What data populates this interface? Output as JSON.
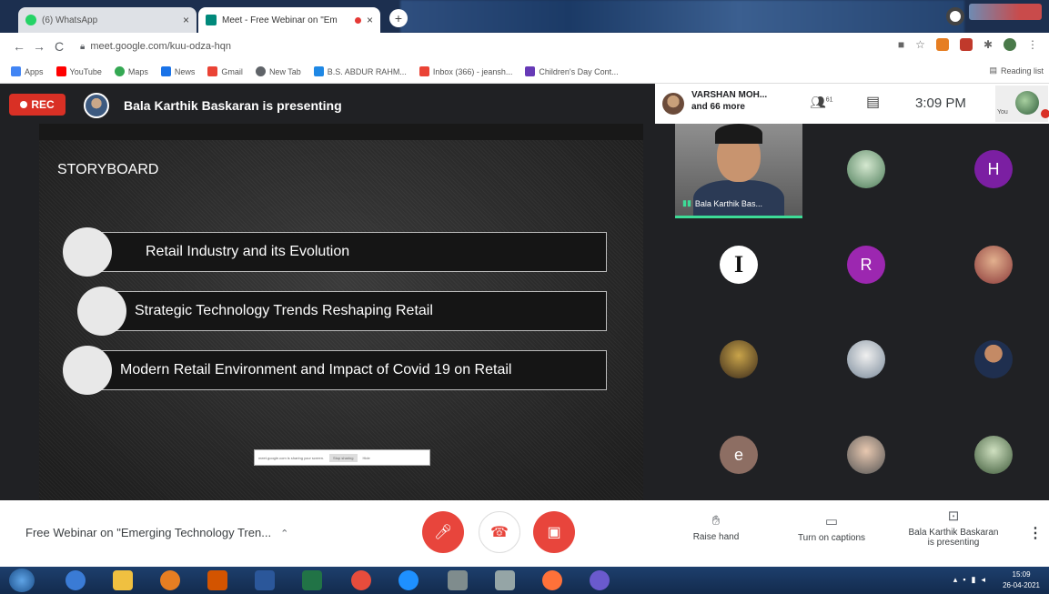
{
  "browser": {
    "tabs": [
      {
        "title": "(6) WhatsApp",
        "close": "×"
      },
      {
        "title": "Meet - Free Webinar on \"Em",
        "close": "×"
      }
    ],
    "new_tab": "+",
    "url": "meet.google.com/kuu-odza-hqn",
    "bookmarks": [
      "Apps",
      "YouTube",
      "Maps",
      "News",
      "Gmail",
      "New Tab",
      "B.S. ABDUR RAHM...",
      "Inbox (366) - jeansh...",
      "Children's Day Cont..."
    ],
    "reading_list": "Reading list"
  },
  "meet": {
    "rec_label": "REC",
    "presenting_banner": "Bala Karthik Baskaran is presenting",
    "top_names_line1": "VARSHAN MOH...",
    "top_names_line2": "and 66 more",
    "people_count": "61",
    "time": "3:09 PM",
    "you_label": "You",
    "slide": {
      "title": "STORYBOARD",
      "items": [
        "Retail Industry and its Evolution",
        "Strategic Technology Trends Reshaping Retail",
        "Modern Retail Environment and Impact of Covid 19 on Retail"
      ],
      "share_notice": "meet.google.com is sharing your screen.",
      "share_stop": "Stop sharing",
      "share_hide": "Hide"
    },
    "tiles": {
      "video_label": "Bala Karthik Bas...",
      "initials": {
        "h": "H",
        "r": "R",
        "i": "I",
        "e": "e"
      },
      "colors": {
        "h": "#7b1fa2",
        "r": "#9c27b0",
        "e": "#8d6e63"
      }
    },
    "bottom": {
      "meeting_title": "Free Webinar on \"Emerging Technology Tren...",
      "raise_hand": "Raise hand",
      "captions": "Turn on captions",
      "presenting_line1": "Bala Karthik Baskaran",
      "presenting_line2": "is presenting"
    }
  },
  "taskbar": {
    "time": "15:09",
    "date": "26-04-2021"
  }
}
